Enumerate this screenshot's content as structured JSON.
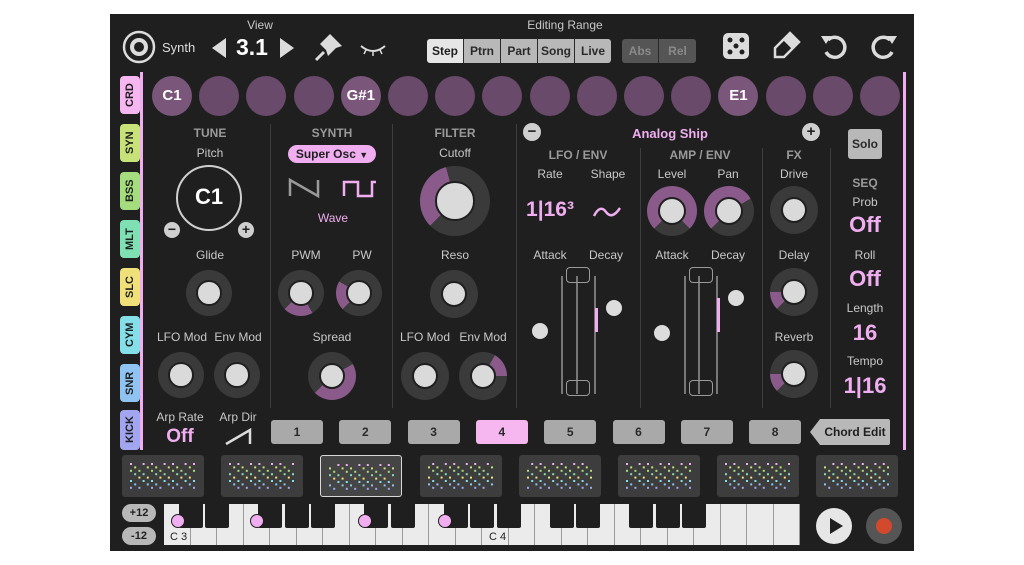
{
  "topbar": {
    "synth_label": "Synth",
    "view_label": "View",
    "view_value": "3.1",
    "editing_range_label": "Editing Range",
    "range_buttons": [
      "Step",
      "Ptrn",
      "Part",
      "Song",
      "Live"
    ],
    "range_selected": "Step",
    "mode_buttons": [
      "Abs",
      "Rel"
    ]
  },
  "chords": [
    "C1",
    "",
    "",
    "",
    "G#1",
    "",
    "",
    "",
    "",
    "",
    "",
    "",
    "E1",
    "",
    "",
    ""
  ],
  "side_tabs": [
    "CRD",
    "SYN",
    "BSS",
    "MLT",
    "SLC",
    "CYM",
    "SNR",
    "KICK"
  ],
  "side_tab_colors": [
    "#f6b6f0",
    "#c8e27a",
    "#a5dd7e",
    "#7fe0b4",
    "#f0e07a",
    "#84dfe8",
    "#8fc4f2",
    "#a2a6f0"
  ],
  "tune": {
    "header": "TUNE",
    "pitch_label": "Pitch",
    "pitch_value": "C1",
    "glide_label": "Glide",
    "lfo_mod_label": "LFO Mod",
    "env_mod_label": "Env Mod",
    "arp_rate_label": "Arp Rate",
    "arp_rate_value": "Off",
    "arp_dir_label": "Arp Dir"
  },
  "synth": {
    "header": "SYNTH",
    "osc_type": "Super Osc",
    "wave_label": "Wave",
    "pwm_label": "PWM",
    "pw_label": "PW",
    "spread_label": "Spread"
  },
  "filter": {
    "header": "FILTER",
    "cutoff_label": "Cutoff",
    "reso_label": "Reso",
    "lfo_mod_label": "LFO Mod",
    "env_mod_label": "Env Mod"
  },
  "preset_name": "Analog Ship",
  "lfo_env": {
    "header": "LFO / ENV",
    "rate_label": "Rate",
    "rate_value": "1|16³",
    "shape_label": "Shape",
    "attack_label": "Attack",
    "decay_label": "Decay"
  },
  "amp_env": {
    "header": "AMP / ENV",
    "level_label": "Level",
    "pan_label": "Pan",
    "attack_label": "Attack",
    "decay_label": "Decay"
  },
  "fx": {
    "header": "FX",
    "drive_label": "Drive",
    "delay_label": "Delay",
    "reverb_label": "Reverb"
  },
  "seq": {
    "solo_label": "Solo",
    "header": "SEQ",
    "prob_label": "Prob",
    "prob_value": "Off",
    "roll_label": "Roll",
    "roll_value": "Off",
    "length_label": "Length",
    "length_value": "16",
    "tempo_label": "Tempo",
    "tempo_value": "1|16"
  },
  "pages": [
    "1",
    "2",
    "3",
    "4",
    "5",
    "6",
    "7",
    "8"
  ],
  "page_selected": "4",
  "chord_edit_label": "Chord Edit",
  "keyboard": {
    "octave_up": "+12",
    "octave_down": "-12",
    "c3_label": "C 3",
    "c4_label": "C 4"
  },
  "colors": {
    "accent": "#f0aef0",
    "background": "#1f1f1f",
    "chord_pad": "#6a4a6a"
  }
}
